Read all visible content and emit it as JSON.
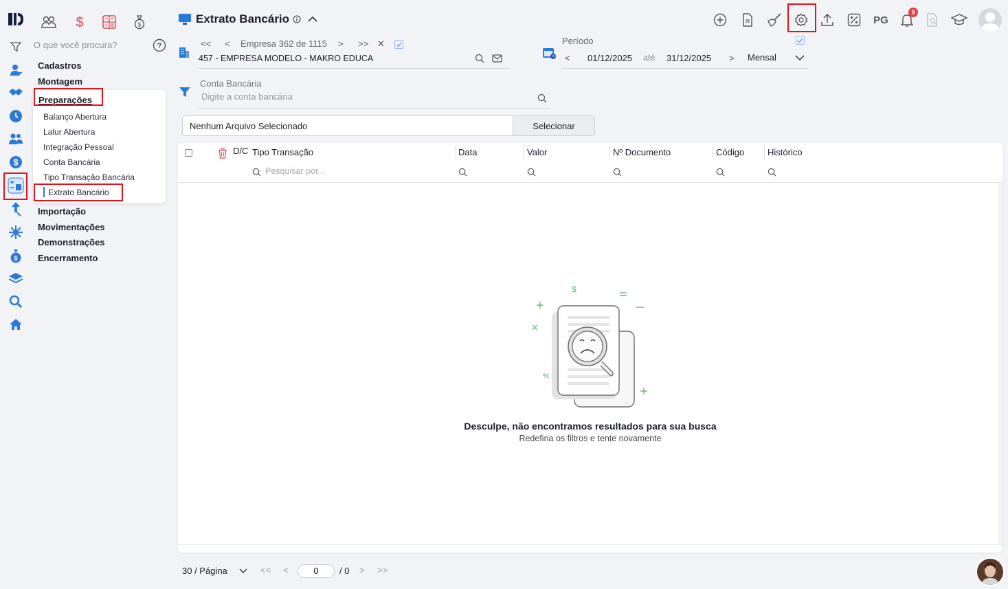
{
  "search": {
    "placeholder": "O que você procura?"
  },
  "menu": {
    "sections": [
      "Cadastros",
      "Montagem",
      "Preparações",
      "Importação",
      "Movimentações",
      "Demonstrações",
      "Encerramento"
    ],
    "submenu": [
      "Balanço Abertura",
      "Lalur Abertura",
      "Integração Pessoal",
      "Conta Bancária",
      "Tipo Transação Bancária",
      "Extrato Bancário"
    ]
  },
  "header": {
    "title": "Extrato Bancário",
    "pg_label": "PG",
    "notification_count": "9"
  },
  "empresa": {
    "nav_label": "Empresa 362 de 1115",
    "name": "457 - EMPRESA MODELO - MAKRO EDUCA"
  },
  "periodo": {
    "label": "Período",
    "start": "01/12/2025",
    "separator": "até",
    "end": "31/12/2025",
    "mode": "Mensal"
  },
  "conta": {
    "label": "Conta Bancária",
    "placeholder": "Digite a conta bancária"
  },
  "file": {
    "name": "Nenhum Arquivo Selecionado",
    "button": "Selecionar"
  },
  "table": {
    "dc_label": "D/C",
    "columns": [
      "Tipo Transação",
      "Data",
      "Valor",
      "Nº Documento",
      "Código",
      "Histórico"
    ],
    "filter_placeholder": "Pesquisar por...",
    "empty_title": "Desculpe, não encontramos resultados para sua busca",
    "empty_subtitle": "Redefina os filtros e tente novamente"
  },
  "pagination": {
    "page_size": "30 / Página",
    "current": "0",
    "total": "/ 0"
  },
  "colors": {
    "accent": "#2a7bd8",
    "highlight": "#e0141e",
    "empty_icon": "#5aa86a"
  }
}
